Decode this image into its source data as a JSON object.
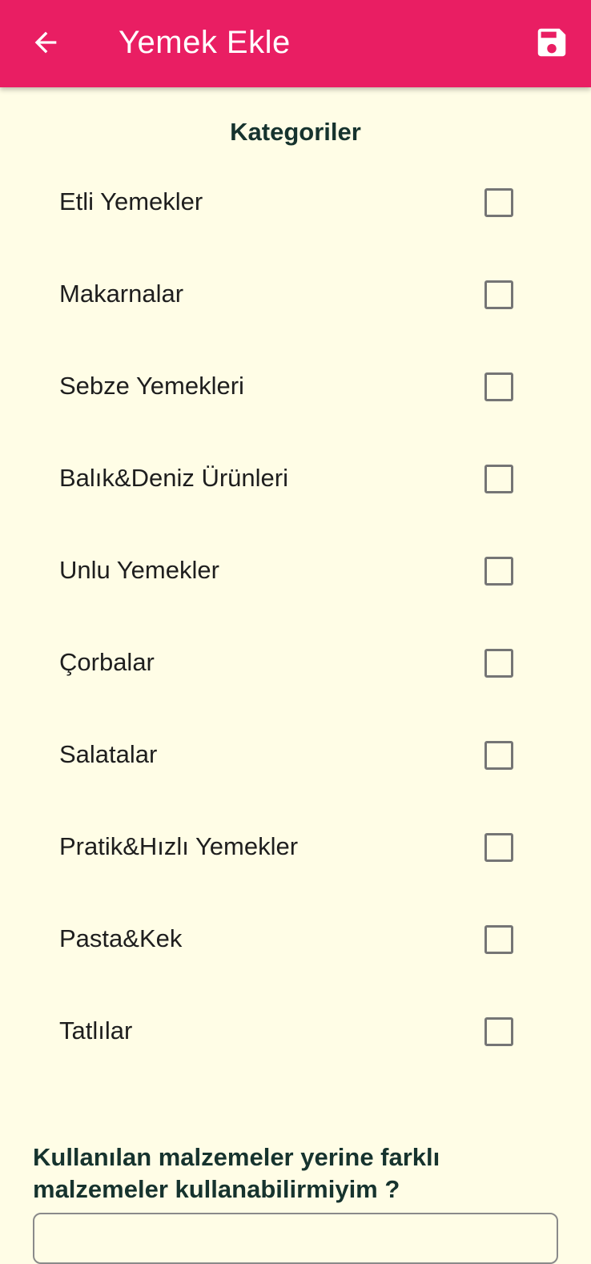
{
  "appbar": {
    "title": "Yemek Ekle",
    "back_icon": "arrow-left-icon",
    "save_icon": "floppy-disk-icon",
    "color": "#E91E63"
  },
  "categories": {
    "title": "Kategoriler",
    "items": [
      {
        "label": "Etli Yemekler",
        "checked": false
      },
      {
        "label": "Makarnalar",
        "checked": false
      },
      {
        "label": "Sebze Yemekleri",
        "checked": false
      },
      {
        "label": "Balık&Deniz Ürünleri",
        "checked": false
      },
      {
        "label": "Unlu Yemekler",
        "checked": false
      },
      {
        "label": "Çorbalar",
        "checked": false
      },
      {
        "label": "Salatalar",
        "checked": false
      },
      {
        "label": "Pratik&Hızlı Yemekler",
        "checked": false
      },
      {
        "label": "Pasta&Kek",
        "checked": false
      },
      {
        "label": "Tatlılar",
        "checked": false
      }
    ]
  },
  "question": {
    "text": "Kullanılan malzemeler yerine farklı malzemeler kullanabilirmiyim ?",
    "value": ""
  },
  "colors": {
    "background": "#FFFDE6",
    "heading": "#16332E",
    "checkbox_border": "#757575"
  }
}
